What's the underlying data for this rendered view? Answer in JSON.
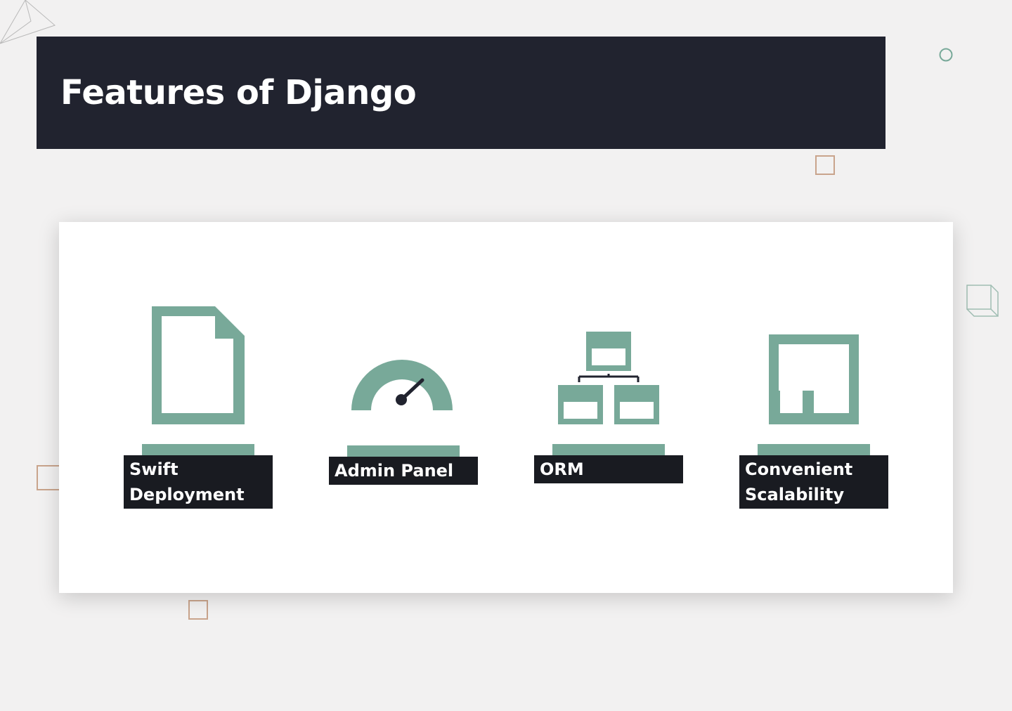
{
  "title": "Features of Django",
  "colors": {
    "background": "#f2f1f1",
    "banner": "#21232f",
    "accent": "#78a999",
    "label_background": "#191b21",
    "decoration_tan": "#c9a48c"
  },
  "features": [
    {
      "label": "Swift Deployment",
      "icon": "document-icon"
    },
    {
      "label": "Admin Panel",
      "icon": "speedometer-icon"
    },
    {
      "label": "ORM",
      "icon": "hierarchy-icon"
    },
    {
      "label": "Convenient Scalability",
      "icon": "scale-layout-icon"
    }
  ]
}
